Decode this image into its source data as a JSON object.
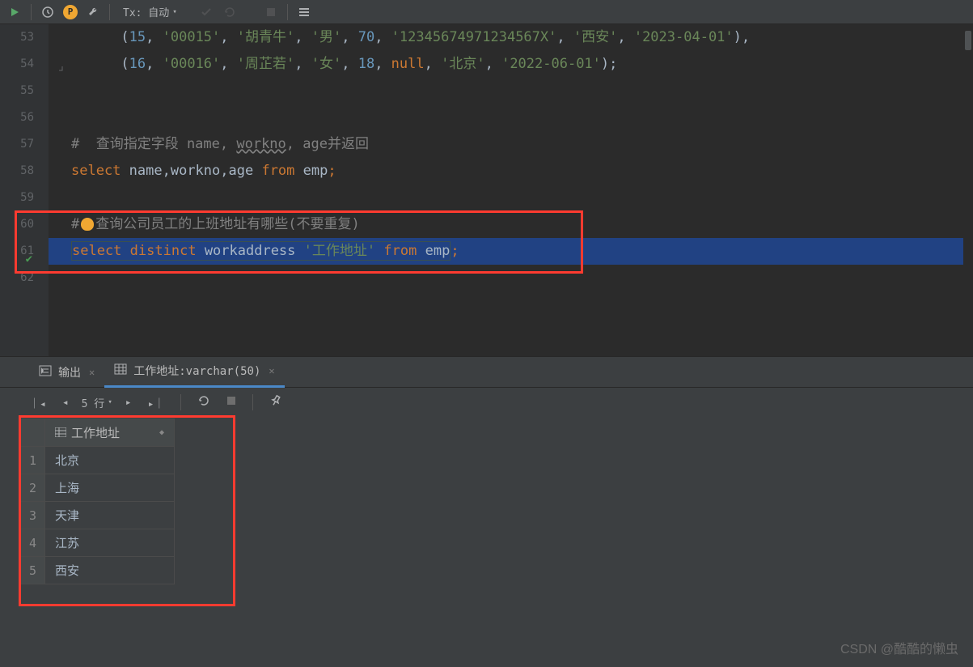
{
  "toolbar": {
    "tx_label": "Tx: 自动"
  },
  "editor": {
    "lines": [
      {
        "num": "53"
      },
      {
        "num": "54"
      },
      {
        "num": "55"
      },
      {
        "num": "56"
      },
      {
        "num": "57"
      },
      {
        "num": "58"
      },
      {
        "num": "59"
      },
      {
        "num": "60"
      },
      {
        "num": "61"
      },
      {
        "num": "62"
      }
    ],
    "code": {
      "l53": {
        "paren_open": "      (",
        "n1": "15",
        "c1": ", ",
        "s1": "'00015'",
        "c2": ", ",
        "s2": "'胡青牛'",
        "c3": ", ",
        "s3": "'男'",
        "c4": ", ",
        "n2": "70",
        "c5": ", ",
        "s4": "'12345674971234567X'",
        "c6": ", ",
        "s5": "'西安'",
        "c7": ", ",
        "s6": "'2023-04-01'",
        "paren_close": "),"
      },
      "l54": {
        "paren_open": "      (",
        "n1": "16",
        "c1": ", ",
        "s1": "'00016'",
        "c2": ", ",
        "s2": "'周芷若'",
        "c3": ", ",
        "s3": "'女'",
        "c4": ", ",
        "n2": "18",
        "c5": ", ",
        "null": "null",
        "c6": ", ",
        "s4": "'北京'",
        "c7": ", ",
        "s5": "'2022-06-01'",
        "paren_close": ");"
      },
      "l57": {
        "hash": "#  查询指定字段 name, ",
        "workno": "workno",
        "rest": ", age并返回"
      },
      "l58": {
        "select": "select",
        "sp1": " ",
        "fields": "name,workno,age",
        "sp2": " ",
        "from": "from",
        "sp3": " ",
        "table": "emp",
        "semi": ";"
      },
      "l60": {
        "hash": "#",
        "text": "查询公司员工的上班地址有哪些(不要重复)"
      },
      "l61": {
        "select": "select",
        "sp1": " ",
        "distinct": "distinct",
        "sp2": " ",
        "col": "workaddress",
        "sp3": " ",
        "alias": "'工作地址'",
        "sp4": " ",
        "from": "from",
        "sp5": " ",
        "table": "emp",
        "semi": ";"
      }
    }
  },
  "results": {
    "tab_output": "输出",
    "tab_result": "工作地址:varchar(50)",
    "row_count": "5 行",
    "column_header": "工作地址",
    "rows": [
      {
        "n": "1",
        "v": "北京"
      },
      {
        "n": "2",
        "v": "上海"
      },
      {
        "n": "3",
        "v": "天津"
      },
      {
        "n": "4",
        "v": "江苏"
      },
      {
        "n": "5",
        "v": "西安"
      }
    ]
  },
  "watermark": "CSDN @酷酷的懒虫"
}
